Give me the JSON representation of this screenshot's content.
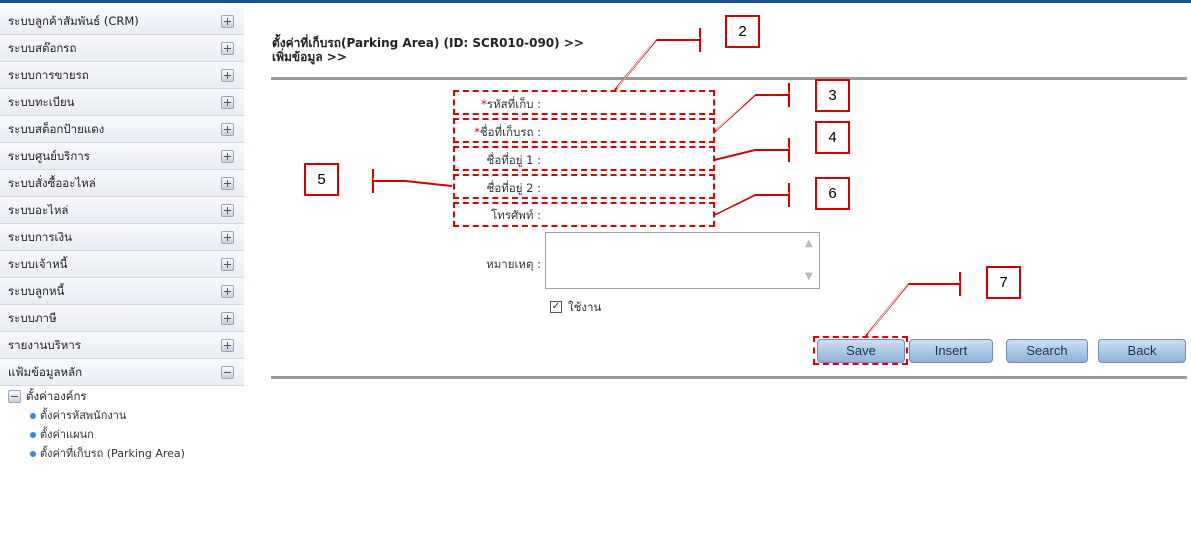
{
  "sidebar": {
    "items": [
      {
        "label": "ระบบลูกค้าสัมพันธ์ (CRM)",
        "state": "collapsed"
      },
      {
        "label": "ระบบสต๊อกรถ",
        "state": "collapsed"
      },
      {
        "label": "ระบบการขายรถ",
        "state": "collapsed"
      },
      {
        "label": "ระบบทะเบียน",
        "state": "collapsed"
      },
      {
        "label": "ระบบสต็อกป้ายแดง",
        "state": "collapsed"
      },
      {
        "label": "ระบบศูนย์บริการ",
        "state": "collapsed"
      },
      {
        "label": "ระบบสั่งซื้ออะไหล่",
        "state": "collapsed"
      },
      {
        "label": "ระบบอะไหล่",
        "state": "collapsed"
      },
      {
        "label": "ระบบการเงิน",
        "state": "collapsed"
      },
      {
        "label": "ระบบเจ้าหนี้",
        "state": "collapsed"
      },
      {
        "label": "ระบบลูกหนี้",
        "state": "collapsed"
      },
      {
        "label": "ระบบภาษี",
        "state": "collapsed"
      },
      {
        "label": "รายงานบริหาร",
        "state": "collapsed"
      },
      {
        "label": "แฟ้มข้อมูลหลัก",
        "state": "expanded"
      }
    ],
    "sub_group": "ตั้งค่าองค์กร",
    "sub_items": [
      "ตั้งค่ารหัสพนักงาน",
      "ตั้งค่าแผนก",
      "ตั้งค่าที่เก็บรถ (Parking Area)"
    ]
  },
  "page": {
    "title_line1": "ตั้งค่าที่เก็บรถ(Parking Area) (ID: SCR010-090) >>",
    "title_line2": "เพิ่มข้อมูล >>"
  },
  "form": {
    "required_mark": "*",
    "parking_code_label": "รหัสที่เก็บ :",
    "parking_name_label": "ชื่อที่เก็บรถ :",
    "address1_label": "ชื่อที่อยู่ 1 :",
    "address2_label": "ชื่อที่อยู่ 2 :",
    "phone_label": "โทรศัพท์ :",
    "remark_label": "หมายเหตุ :",
    "active_label": "ใช้งาน",
    "active_checked": true,
    "check_glyph": "✓"
  },
  "buttons": {
    "save": "Save",
    "insert": "Insert",
    "search": "Search",
    "back": "Back"
  },
  "annotations": {
    "n2": "2",
    "n3": "3",
    "n4": "4",
    "n5": "5",
    "n6": "6",
    "n7": "7"
  },
  "colors": {
    "annotation_red": "#e00000",
    "button_blue": "#8fb0d9",
    "header_blue": "#1f4e8f"
  }
}
